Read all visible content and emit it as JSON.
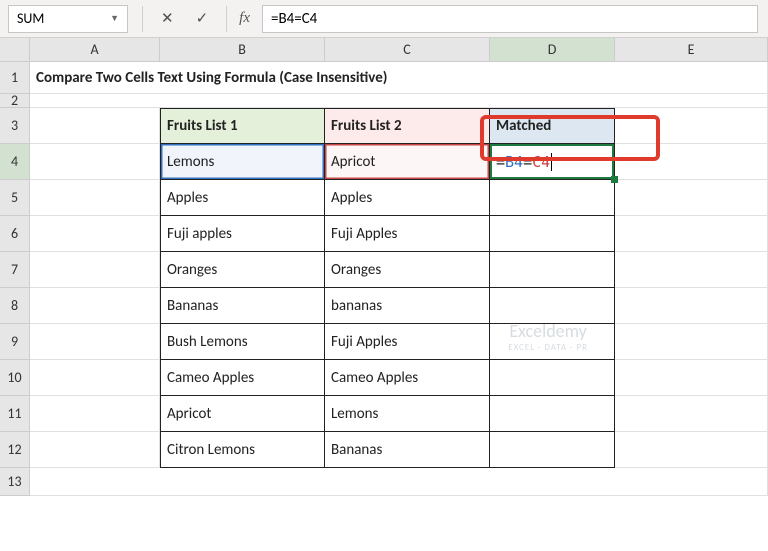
{
  "namebox": "SUM",
  "formula": {
    "raw": "=B4=C4",
    "refB": "B4",
    "refC": "C4"
  },
  "columns": [
    "A",
    "B",
    "C",
    "D",
    "E"
  ],
  "rows": [
    "1",
    "2",
    "3",
    "4",
    "5",
    "6",
    "7",
    "8",
    "9",
    "10",
    "11",
    "12",
    "13"
  ],
  "title": "Compare Two Cells Text Using Formula (Case Insensitive)",
  "headers": {
    "col1": "Fruits List 1",
    "col2": "Fruits List 2",
    "col3": "Matched"
  },
  "table": [
    {
      "a": "Lemons",
      "b": "Apricot"
    },
    {
      "a": "Apples",
      "b": "Apples"
    },
    {
      "a": "Fuji apples",
      "b": "Fuji Apples"
    },
    {
      "a": "Oranges",
      "b": "Oranges"
    },
    {
      "a": "Bananas",
      "b": "bananas"
    },
    {
      "a": "Bush Lemons",
      "b": "Fuji Apples"
    },
    {
      "a": "Cameo Apples",
      "b": "Cameo Apples"
    },
    {
      "a": "Apricot",
      "b": "Lemons"
    },
    {
      "a": "Citron Lemons",
      "b": "Bananas"
    }
  ],
  "watermark": {
    "main": "Exceldemy",
    "sub": "EXCEL · DATA · PR"
  }
}
